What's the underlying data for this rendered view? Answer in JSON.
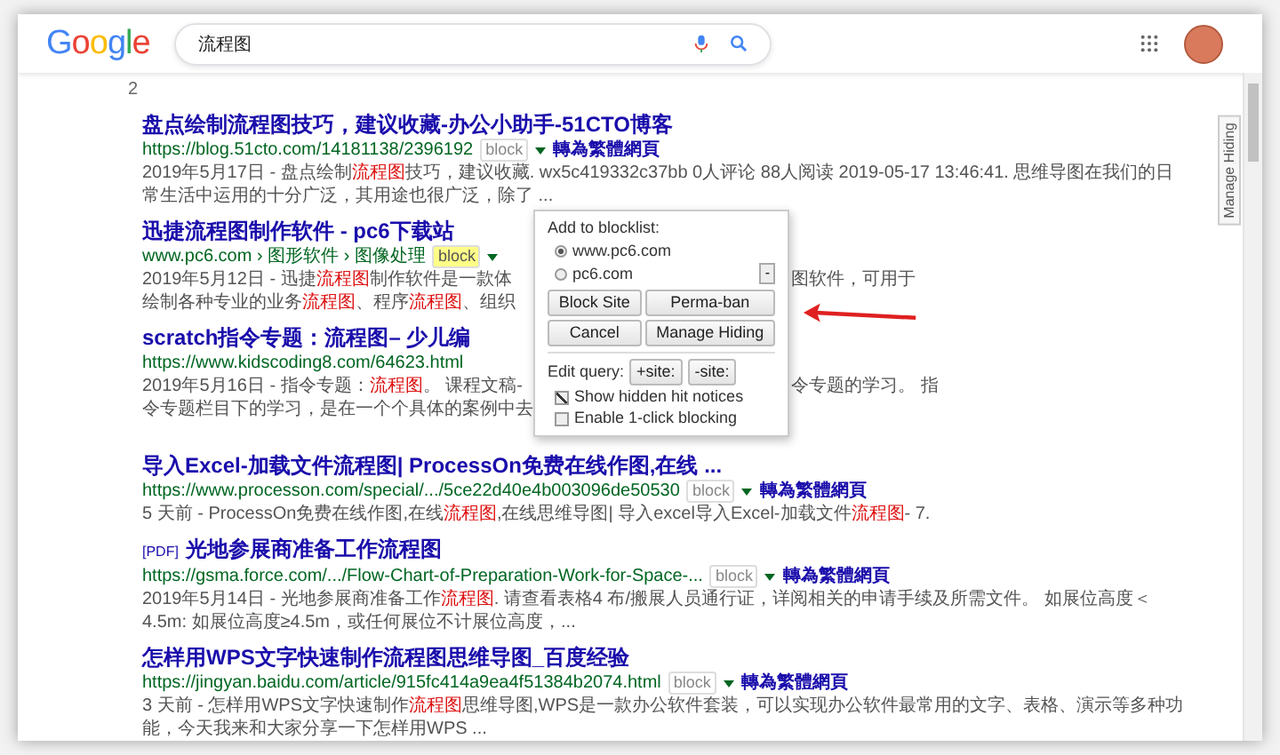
{
  "header": {
    "logo": "Google",
    "search": {
      "value": "流程图"
    }
  },
  "page_number": "2",
  "side_tab": {
    "label": "Manage Hiding"
  },
  "results": [
    {
      "title": {
        "left": "盘点绘制流程图技巧，建议收藏-办公小助手-51CTO博客"
      },
      "url": "https://blog.51cto.com/14181138/2396192",
      "block": {
        "label": "block",
        "highlighted": false
      },
      "translate": "轉為繁體網頁",
      "snippet": [
        {
          "left": [
            {
              "text": "2019年5月17日 - 盘点绘制",
              "hit": false
            },
            {
              "text": "流程图",
              "hit": true
            },
            {
              "text": "技巧，建议收藏. wx5c419332c37bb 0人评论 88人阅读 2019-05-17 13:46:41. 思维导图在我们的日常生活中运用的十分广泛，其用途也很广泛，除了 ...",
              "hit": false
            }
          ]
        }
      ]
    },
    {
      "title": {
        "left": "迅捷流程图制作软件 - pc6下载站"
      },
      "url": "www.pc6.com › 图形软件 › 图像处理",
      "block": {
        "label": "block",
        "highlighted": true
      },
      "snippet": [
        {
          "left": [
            {
              "text": "2019年5月12日 - 迅捷",
              "hit": false
            },
            {
              "text": "流程图",
              "hit": true
            },
            {
              "text": "制作软件是一款体",
              "hit": false
            }
          ],
          "right": [
            {
              "text": "图软件，可用于",
              "hit": false
            }
          ]
        },
        {
          "left": [
            {
              "text": "绘制各种专业的业务",
              "hit": false
            },
            {
              "text": "流程图",
              "hit": true
            },
            {
              "text": "、程序",
              "hit": false
            },
            {
              "text": "流程图",
              "hit": true
            },
            {
              "text": "、组织",
              "hit": false
            }
          ]
        }
      ]
    },
    {
      "title": {
        "left": "scratch指令专题：流程图– 少儿编"
      },
      "url": "https://www.kidscoding8.com/64623.html",
      "snippet": [
        {
          "left": [
            {
              "text": "2019年5月16日 - 指令专题：",
              "hit": false
            },
            {
              "text": "流程图",
              "hit": true
            },
            {
              "text": "。 课程文稿-",
              "hit": false
            }
          ],
          "right": [
            {
              "text": "令专题的学习。 指",
              "hit": false
            }
          ]
        },
        {
          "left": [
            {
              "text": "令专题栏目下的学习，是在一个个具体的案例中去",
              "hit": false
            }
          ]
        }
      ]
    },
    {
      "title": {
        "left": "导入Excel-加载文件流程图| ProcessOn免费在线作图,在线 ..."
      },
      "url": "https://www.processon.com/special/.../5ce22d40e4b003096de50530",
      "block": {
        "label": "block",
        "highlighted": false
      },
      "translate": "轉為繁體網頁",
      "snippet": [
        {
          "left": [
            {
              "text": "5 天前 - ProcessOn免费在线作图,在线",
              "hit": false
            },
            {
              "text": "流程图",
              "hit": true
            },
            {
              "text": ",在线思维导图| 导入excel导入Excel-加载文件",
              "hit": false
            },
            {
              "text": "流程图",
              "hit": true
            },
            {
              "text": "- 7.",
              "hit": false
            }
          ]
        }
      ]
    },
    {
      "tag": "[PDF]",
      "title": {
        "left": "光地参展商准备工作流程图"
      },
      "url": "https://gsma.force.com/.../Flow-Chart-of-Preparation-Work-for-Space-...",
      "block": {
        "label": "block",
        "highlighted": false
      },
      "translate": "轉為繁體網頁",
      "snippet": [
        {
          "left": [
            {
              "text": "2019年5月14日 - 光地参展商准备工作",
              "hit": false
            },
            {
              "text": "流程图",
              "hit": true
            },
            {
              "text": ". 请查看表格4 布/搬展人员通行证，详阅相关的申请手续及所需文件。 如展位高度＜4.5m: 如展位高度≥4.5m，或任何展位不计展位高度，...",
              "hit": false
            }
          ]
        }
      ]
    },
    {
      "title": {
        "left": "怎样用WPS文字快速制作流程图思维导图_百度经验"
      },
      "url": "https://jingyan.baidu.com/article/915fc414a9ea4f51384b2074.html",
      "block": {
        "label": "block",
        "highlighted": false
      },
      "translate": "轉為繁體網頁",
      "snippet": [
        {
          "left": [
            {
              "text": "3 天前 - 怎样用WPS文字快速制作",
              "hit": false
            },
            {
              "text": "流程图",
              "hit": true
            },
            {
              "text": "思维导图,WPS是一款办公软件套装，可以实现办公软件最常用的文字、表格、演示等多种功能，今天我来和大家分享一下怎样用WPS ...",
              "hit": false
            }
          ]
        }
      ]
    }
  ],
  "popup": {
    "heading": "Add to blocklist:",
    "options": [
      {
        "label": "www.pc6.com",
        "selected": true
      },
      {
        "label": "pc6.com",
        "selected": false
      }
    ],
    "collapse": "-",
    "buttons": [
      "Block Site",
      "Perma-ban",
      "Cancel",
      "Manage Hiding"
    ],
    "edit_label": "Edit query:",
    "edit_buttons": [
      "+site:",
      "-site:"
    ],
    "checks": [
      {
        "label": "Show hidden hit notices",
        "checked": true
      },
      {
        "label": "Enable 1-click blocking",
        "checked": false
      }
    ]
  }
}
